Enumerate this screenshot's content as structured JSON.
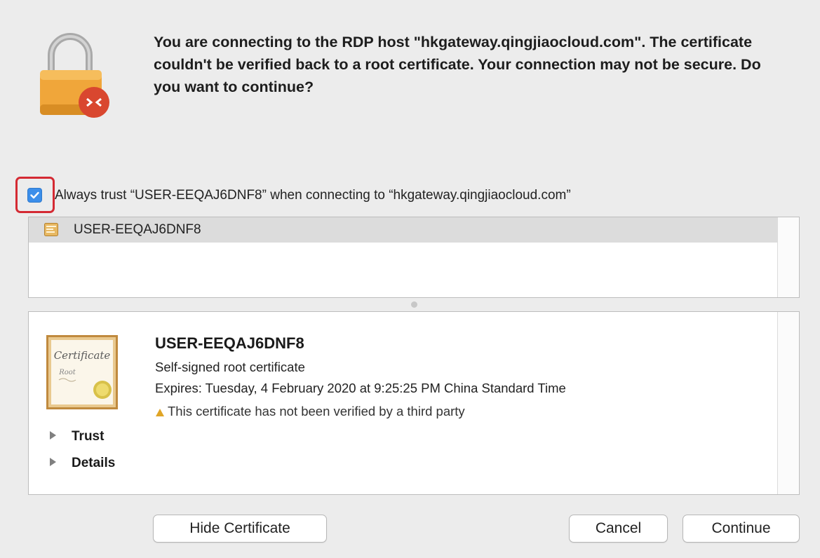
{
  "dialog": {
    "message": "You are connecting to the RDP host \"hkgateway.qingjiaocloud.com\". The certificate couldn't be verified back to a root certificate. Your connection may not be secure. Do you want to continue?",
    "trust_checkbox": {
      "checked": true,
      "label": "Always trust “USER-EEQAJ6DNF8” when connecting to “hkgateway.qingjiaocloud.com”"
    },
    "certificate_list": [
      {
        "name": "USER-EEQAJ6DNF8",
        "selected": true
      }
    ],
    "certificate_detail": {
      "title": "USER-EEQAJ6DNF8",
      "subtitle": "Self-signed root certificate",
      "expires": "Expires: Tuesday, 4 February 2020 at 9:25:25 PM China Standard Time",
      "warning": "This certificate has not been verified by a third party",
      "certificate_image_text": {
        "line1": "Certificate",
        "line2": "Root"
      },
      "sections": [
        {
          "label": "Trust"
        },
        {
          "label": "Details"
        }
      ]
    },
    "buttons": {
      "hide_certificate": "Hide Certificate",
      "cancel": "Cancel",
      "continue": "Continue"
    }
  },
  "colors": {
    "background": "#ececec",
    "checkbox": "#3b8eea",
    "highlight": "#d42a33",
    "lock_body": "#f0a63a",
    "rdp_badge": "#d9472f"
  },
  "icons": {
    "lock": "lock-icon",
    "rdp": "remote-desktop-badge-icon",
    "certificate": "certificate-icon",
    "warning": "warning-triangle-icon",
    "disclosure": "disclosure-triangle-icon"
  }
}
